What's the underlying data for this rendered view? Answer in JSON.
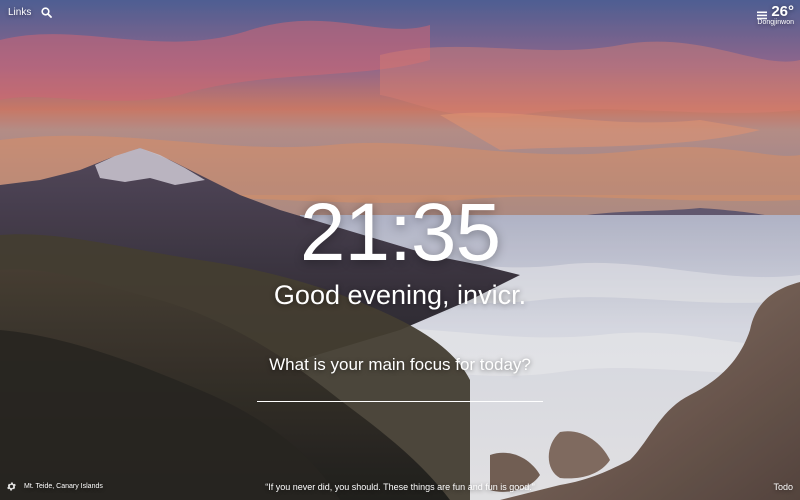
{
  "top_left": {
    "links_label": "Links",
    "search_icon": "search-icon"
  },
  "weather": {
    "icon": "cloud-lines-icon",
    "temperature": "26°",
    "location": "Dongjinwon"
  },
  "center": {
    "time": "21:35",
    "greeting": "Good evening, invicr.",
    "focus_question": "What is your main focus for today?",
    "focus_input_value": ""
  },
  "bottom": {
    "settings_icon": "gear-icon",
    "photo_location": "Mt. Teide, Canary Islands",
    "quote": "“If you never did, you should. These things are fun and fun is good.”",
    "todo_label": "Todo"
  },
  "colors": {
    "text": "#ffffff",
    "sky_top": "#5b6fa8",
    "sunset_glow": "#e58f6c",
    "cloud_sea": "#e9ecf5",
    "mountain_dark": "#3a3536"
  }
}
